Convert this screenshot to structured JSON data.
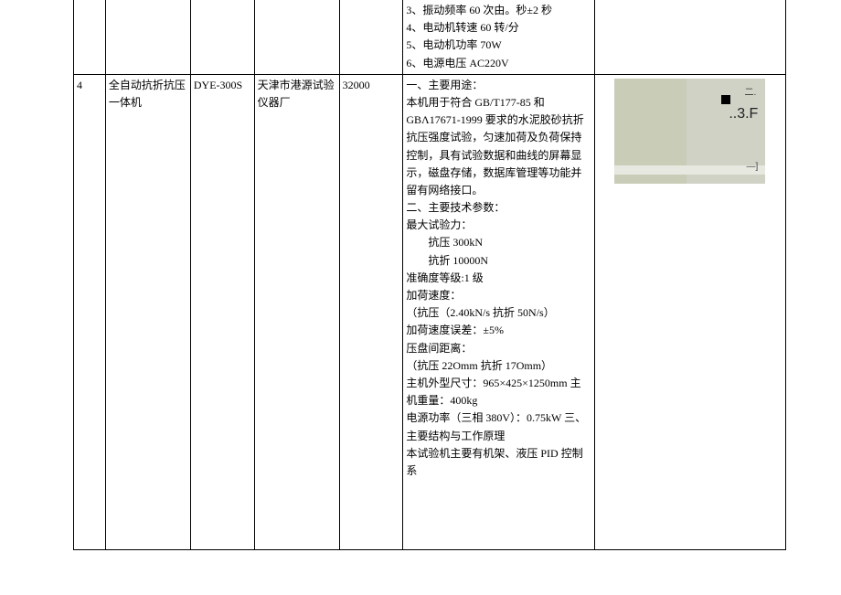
{
  "row1": {
    "desc_lines": [
      "3、振动频率 60 次由。秒±2 秒",
      "4、电动机转速 60 转/分",
      "5、电动机功率 70W",
      "6、电源电压 AC220V"
    ]
  },
  "row2": {
    "num": "4",
    "name": "全自动抗折抗压一体机",
    "model": "DYE-300S",
    "manufacturer": "天津市港源试验仪器厂",
    "price": "32000",
    "desc_lines": [
      "一、主要用途：",
      "",
      "本机用于符合 GB/T177-85 和 GBΛ17671-1999 要求的水泥胶砂抗折抗压强度试验，匀速加荷及负荷保持控制，具有试验数据和曲线的屏幕显示，磁盘存储，数据库管理等功能并留有网络接口。",
      "二、主要技术参数：",
      "最大试验力：",
      "　抗压 300kN",
      "　抗折 10000N",
      "准确度等级:1 级",
      "加荷速度：",
      "（抗压（2.40kN/s 抗折 50N/s）",
      "加荷速度误差：±5%",
      "压盘间距离：",
      "（抗压 22Omm 抗折 17Omm）",
      "主机外型尺寸：965×425×1250mm 主机重量：400kg",
      "电源功率（三相 380V）：0.75kW 三、主要结构与工作原理",
      "本试验机主要有机架、液压 PID 控制系"
    ],
    "img_label_top": "二.",
    "img_label_main": "..3.F",
    "img_label_dash": "—]"
  }
}
